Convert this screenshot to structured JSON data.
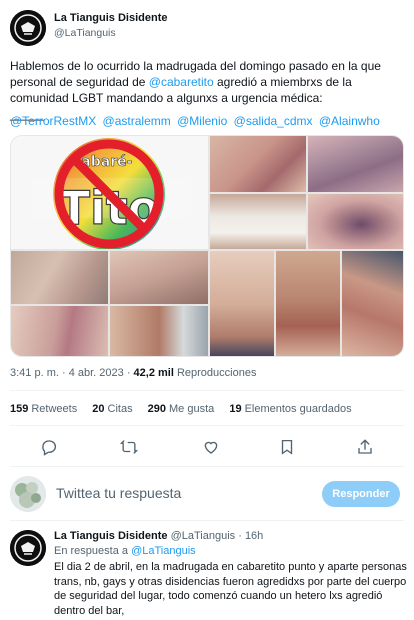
{
  "tweet": {
    "author": {
      "name": "La Tianguis Disidente",
      "handle": "@LaTianguis"
    },
    "text_lines": [
      "Hablemos de lo ocurrido la madrugada del domingo pasado en la que",
      "personal de seguridad de @cabaretito agredió a miembrxs de la",
      "comunidad LGBT mandando a algunxs a urgencia médica:",
      "_____"
    ],
    "mentions": [
      "@TerrorRestMX",
      "@astralemm",
      "@Milenio",
      "@salida_cdmx",
      "@Alainwho"
    ],
    "media": {
      "logo_text": "Cabaré-Tito",
      "photos": [
        "bruised-arm-photo",
        "bruised-skin-photo",
        "bandaged-arm-photo",
        "bruised-leg-photo",
        "scratched-leg-photo",
        "injured-knee-photo",
        "scratched-back-photo",
        "wounded-arm-photo",
        "scratched-forearm-photo",
        "hand-injury-photo",
        "bruised-calf-photo",
        "cut-skin-photo"
      ]
    },
    "timestamp": "3:41 p. m. · 4 abr. 2023",
    "views": {
      "count": "42,2 mil",
      "label": "Reproducciones"
    },
    "stats": {
      "retweets": {
        "count": "159",
        "label": "Retweets"
      },
      "quotes": {
        "count": "20",
        "label": "Citas"
      },
      "likes": {
        "count": "290",
        "label": "Me gusta"
      },
      "bookmarks": {
        "count": "19",
        "label": "Elementos guardados"
      }
    }
  },
  "reply_box": {
    "placeholder": "Twittea tu respuesta",
    "button_label": "Responder"
  },
  "reply": {
    "author": {
      "name": "La Tianguis Disidente",
      "handle": "@LaTianguis"
    },
    "time": "16h",
    "in_reply_prefix": "En respuesta a",
    "in_reply_to": "@LaTianguis",
    "text_lines": [
      "El dia 2 de abril, en la madrugada en cabaretito punto y aparte personas",
      "trans, nb, gays y otras disidencias  fueron agredidxs por parte del cuerpo",
      "de seguridad del lugar, todo comenzó cuando un hetero lxs agredió",
      "dentro del bar,"
    ]
  },
  "icons": [
    "reply-icon",
    "retweet-icon",
    "like-icon",
    "bookmark-icon",
    "share-icon"
  ],
  "colors": {
    "accent": "#1d9bf0",
    "muted": "#536471",
    "button": "#8ecdf8"
  }
}
